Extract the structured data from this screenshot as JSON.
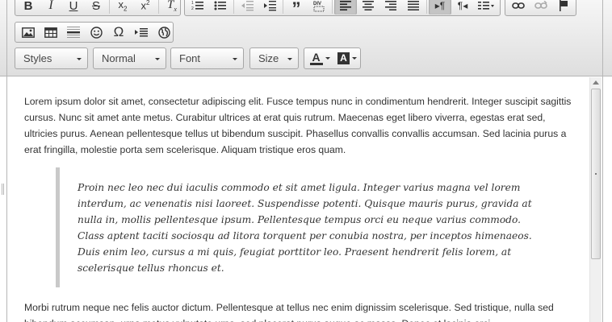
{
  "toolbar": {
    "row1": [
      {
        "name": "bold-button",
        "icon": "bold-icon",
        "glyph": "B"
      },
      {
        "name": "italic-button",
        "icon": "italic-icon",
        "glyph": "I"
      },
      {
        "name": "underline-button",
        "icon": "underline-icon",
        "glyph": "U"
      },
      {
        "name": "strikethrough-button",
        "icon": "strikethrough-icon",
        "glyph": "S"
      },
      {
        "name": "subscript-button",
        "icon": "subscript-icon",
        "glyph": "x₂"
      },
      {
        "name": "superscript-button",
        "icon": "superscript-icon",
        "glyph": "x²"
      },
      {
        "name": "remove-format-button",
        "icon": "remove-format-icon",
        "glyph": "Tx"
      }
    ],
    "format_combos": {
      "styles": "Styles",
      "format": "Normal",
      "font": "Font",
      "size": "Size"
    },
    "text_color_glyph": "A",
    "bg_color_glyph": "A",
    "align_active": "left",
    "ltr_active": true
  },
  "editor": {
    "paragraph1": "Lorem ipsum dolor sit amet, consectetur adipiscing elit. Fusce tempus nunc in condimentum hendrerit. Integer suscipit sagittis cursus. Nunc sit amet ante metus. Curabitur ultrices at erat quis rutrum. Maecenas eget libero viverra, egestas erat sed, ultricies purus. Aenean pellentesque tellus ut bibendum suscipit. Phasellus convallis convallis accumsan. Sed lacinia purus a erat fringilla, molestie porta sem scelerisque. Aliquam tristique eros quam.",
    "blockquote": "Proin nec leo nec dui iaculis commodo et sit amet ligula. Integer varius magna vel lorem interdum, ac venenatis nisi laoreet. Suspendisse potenti. Quisque mauris purus, gravida at nulla in, mollis pellentesque ipsum. Pellentesque tempus orci eu neque varius commodo. Class aptent taciti sociosqu ad litora torquent per conubia nostra, per inceptos himenaeos. Duis enim leo, cursus a mi quis, feugiat porttitor leo. Praesent hendrerit felis lorem, at scelerisque tellus rhoncus et.",
    "paragraph2": "Morbi rutrum neque nec felis auctor dictum. Pellentesque at tellus nec enim dignissim scelerisque. Sed tristique, nulla sed bibendum accumsan, urna metus vulputate urna, sed placerat purus augue ac massa. Donec et lacinia orci."
  },
  "colors": {
    "toolbar_top": "#f6f6f6",
    "toolbar_bottom": "#dedede",
    "border": "#a6a6a6",
    "active_button": "#c4c4c4",
    "text": "#333333",
    "quote_border": "#c9c9c9"
  }
}
